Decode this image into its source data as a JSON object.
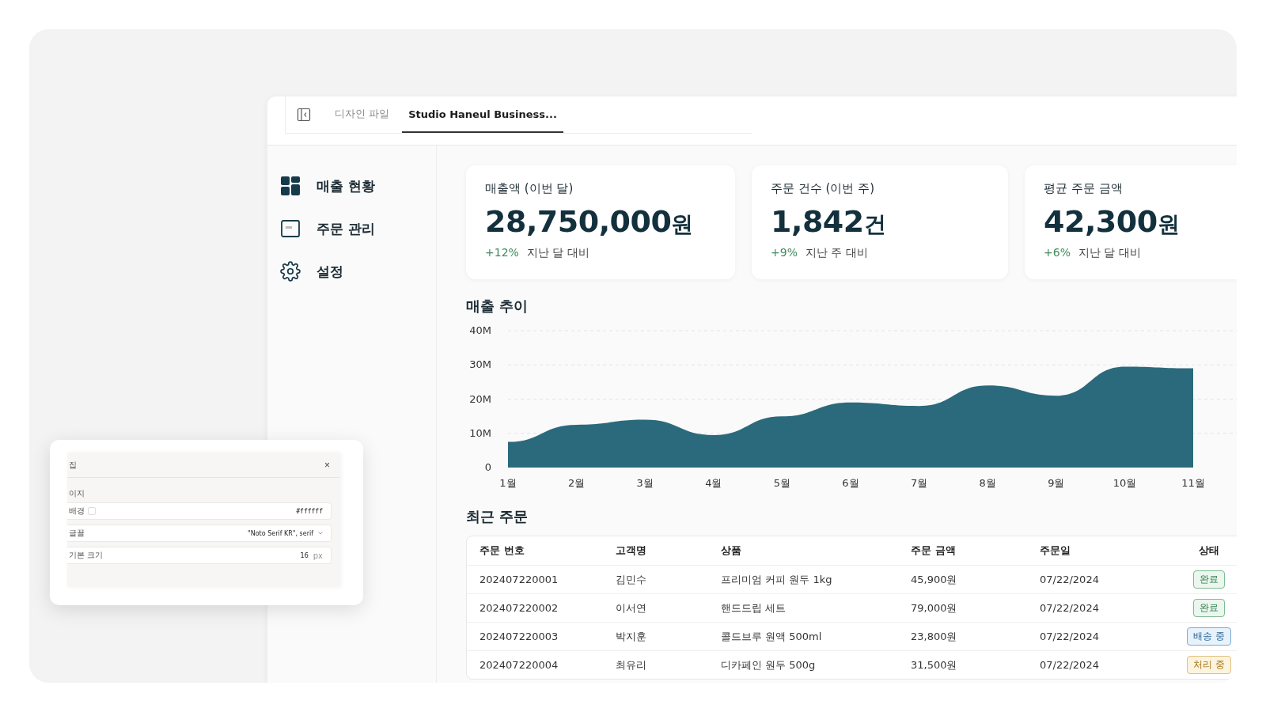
{
  "tabs": [
    {
      "label": "디자인 파일",
      "selected": false
    },
    {
      "label": "Studio Haneul Business...",
      "selected": true
    }
  ],
  "sidebar": {
    "items": [
      {
        "label": "매출 현황",
        "kind": "dashboard"
      },
      {
        "label": "주문 관리",
        "kind": "orders"
      },
      {
        "label": "설정",
        "kind": "settings"
      }
    ]
  },
  "stats": [
    {
      "title": "매출액 (이번 달)",
      "value": "28,750,000",
      "unit": "원",
      "change": "+12%",
      "note": "지난 달 대비"
    },
    {
      "title": "주문 건수 (이번 주)",
      "value": "1,842",
      "unit": "건",
      "change": "+9%",
      "note": "지난 주 대비"
    },
    {
      "title": "평균 주문 금액",
      "value": "42,300",
      "unit": "원",
      "change": "+6%",
      "note": "지난 달 대비"
    }
  ],
  "trend": {
    "title": "매출 추이",
    "chart_data": {
      "type": "area",
      "categories": [
        "1월",
        "2월",
        "3월",
        "4월",
        "5월",
        "6월",
        "7월",
        "8월",
        "9월",
        "10월",
        "11월"
      ],
      "grid": true,
      "series": [
        {
          "color": "#2b6a7c",
          "values": [
            7.5,
            12.5,
            14,
            9.5,
            15,
            19,
            18,
            24,
            21,
            29.5,
            29
          ]
        }
      ],
      "ylim": [
        0,
        40
      ],
      "yticks": [
        {
          "value": 0,
          "label": "0"
        },
        {
          "value": 10,
          "label": "10M"
        },
        {
          "value": 20,
          "label": "20M"
        },
        {
          "value": 30,
          "label": "30M"
        },
        {
          "value": 40,
          "label": "40M"
        }
      ]
    }
  },
  "orders": {
    "title": "최근 주문",
    "columns": [
      "주문 번호",
      "고객명",
      "상품",
      "주문 금액",
      "주문일",
      "상태"
    ],
    "rows": [
      {
        "cells": [
          "202407220001",
          "김민수",
          "프리미엄 커피 원두 1kg",
          "45,900원",
          "07/22/2024"
        ],
        "status": {
          "label": "완료",
          "kind": "done"
        }
      },
      {
        "cells": [
          "202407220002",
          "이서연",
          "핸드드립 세트",
          "79,000원",
          "07/22/2024"
        ],
        "status": {
          "label": "완료",
          "kind": "done"
        }
      },
      {
        "cells": [
          "202407220003",
          "박지훈",
          "콜드브루 원액 500ml",
          "23,800원",
          "07/22/2024"
        ],
        "status": {
          "label": "배송 중",
          "kind": "shipping"
        }
      },
      {
        "cells": [
          "202407220004",
          "최유리",
          "디카페인 원두 500g",
          "31,500원",
          "07/22/2024"
        ],
        "status": {
          "label": "처리 중",
          "kind": "processing"
        }
      }
    ]
  },
  "dialog": {
    "title": "집",
    "close": "×",
    "section": "이지",
    "fields": [
      {
        "label": "배경",
        "kind": "color",
        "value": "#ffffff"
      },
      {
        "label": "글꼴",
        "kind": "select",
        "value": "\"Noto Serif KR\", serif"
      },
      {
        "label": "기본 크기",
        "kind": "number",
        "value": "16",
        "unit": "px"
      }
    ]
  }
}
